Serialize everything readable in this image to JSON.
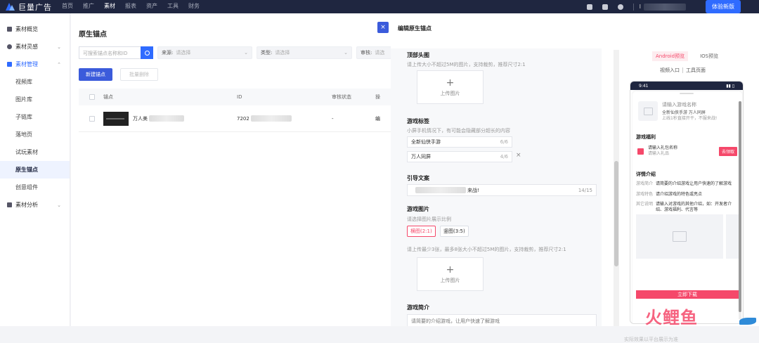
{
  "topbar": {
    "logo_text": "巨量广告",
    "nav": [
      "首页",
      "推广",
      "素材",
      "报表",
      "资产",
      "工具",
      "财务"
    ],
    "nav_active": 2,
    "user_initial": "I",
    "try_button": "体验新版"
  },
  "sidebar": {
    "items": [
      {
        "label": "素材概览",
        "icon": "home-icon",
        "type": "parent"
      },
      {
        "label": "素材灵感",
        "icon": "bulb-icon",
        "type": "parent",
        "chevron": "⌄"
      },
      {
        "label": "素材管理",
        "icon": "layers-icon",
        "type": "parent",
        "chevron": "⌃",
        "active": true
      },
      {
        "label": "视频库",
        "type": "sub"
      },
      {
        "label": "图片库",
        "type": "sub"
      },
      {
        "label": "子链库",
        "type": "sub"
      },
      {
        "label": "落地页",
        "type": "sub"
      },
      {
        "label": "试玩素材",
        "type": "sub"
      },
      {
        "label": "原生锚点",
        "type": "sub",
        "active": true
      },
      {
        "label": "创意组件",
        "type": "sub"
      },
      {
        "label": "素材分析",
        "icon": "chart-icon",
        "type": "parent",
        "chevron": "⌄"
      }
    ]
  },
  "main": {
    "title": "原生锚点",
    "search_placeholder": "可搜索锚点名称和ID",
    "filters": [
      {
        "label": "来源:",
        "placeholder": "请选择"
      },
      {
        "label": "类型:",
        "placeholder": "请选择"
      },
      {
        "label": "审核:",
        "placeholder": "请选"
      }
    ],
    "new_button": "新建锚点",
    "batch_delete": "批量删除",
    "table": {
      "headers": [
        "锚点",
        "ID",
        "审核状态",
        "操"
      ],
      "rows": [
        {
          "name": "万人美",
          "id": "7202",
          "status": "-",
          "op": "编"
        }
      ]
    }
  },
  "drawer": {
    "title": "编辑原生锚点",
    "close": "×",
    "top_image": {
      "title": "顶部头图",
      "hint": "请上传大小不超过5M的图片，支持裁剪，推荐尺寸2:1",
      "upload_label": "上传图片"
    },
    "game_tags": {
      "title": "游戏标签",
      "hint": "小屏手机情况下，有可能会隐藏部分超长的内容",
      "tags": [
        {
          "value": "全新仙侠手游",
          "count": "6/6"
        },
        {
          "value": "万人同屏",
          "count": "4/6"
        }
      ]
    },
    "guide_text": {
      "title": "引导文案",
      "value_suffix": "来战!",
      "count": "14/15"
    },
    "game_images": {
      "title": "游戏图片",
      "ratio_hint": "请选择图片展示比例",
      "ratios": [
        "横图(2:1)",
        "竖图(3:5)"
      ],
      "upload_hint": "请上传最少3张，最多8张大小不超过5M的图片，支持裁剪，推荐尺寸2:1",
      "upload_label": "上传图片"
    },
    "intro": {
      "title": "游戏简介",
      "placeholder": "请简要的介绍游戏，让用户快速了解游戏"
    }
  },
  "preview": {
    "tabs": [
      "Android预览",
      "IOS预览"
    ],
    "links": [
      "视频入口",
      "工具页面"
    ],
    "status_time": "9:41",
    "app_name": "请输入游戏名称",
    "app_tags": "全新仙侠手游 万人同屏",
    "app_sub": "上线1秒直接开干，不服来战!",
    "benefit_title": "游戏福利",
    "gift_name": "请输入礼包名称",
    "gift_desc": "请输入礼品",
    "gift_button": "去领取",
    "detail_title": "详情介绍",
    "details": [
      {
        "k": "游戏简介",
        "v": "请简要的介绍游戏让用户快速的了解游戏"
      },
      {
        "k": "游戏特色",
        "v": "请介绍游戏的特色或亮点"
      },
      {
        "k": "其它说明",
        "v": "请输入对游戏的其他介绍，如：开发者介绍、游戏福利、代言等"
      }
    ],
    "download_button": "立即下载",
    "footer": "实际效果以平台展示为准"
  },
  "watermark": "火鲤鱼"
}
